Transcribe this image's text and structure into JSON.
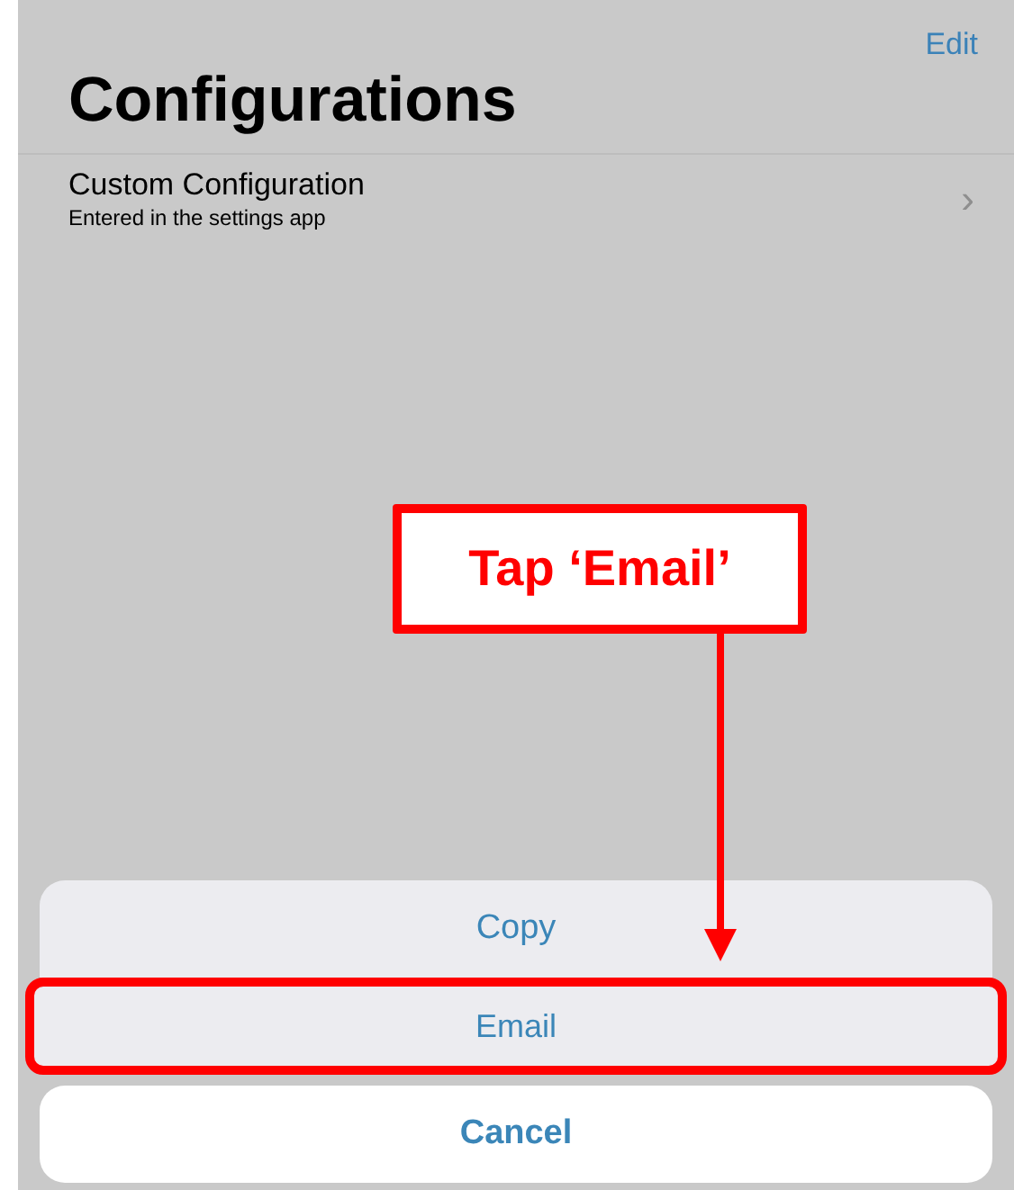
{
  "nav": {
    "edit": "Edit"
  },
  "title": "Configurations",
  "rows": [
    {
      "title": "Custom Configuration",
      "subtitle": "Entered in the settings app",
      "chevron": "›"
    }
  ],
  "action_sheet": {
    "actions": [
      {
        "label": "Copy",
        "highlighted": false
      },
      {
        "label": "Email",
        "highlighted": true
      }
    ],
    "cancel": "Cancel"
  },
  "callout": {
    "text": "Tap ‘Email’"
  }
}
